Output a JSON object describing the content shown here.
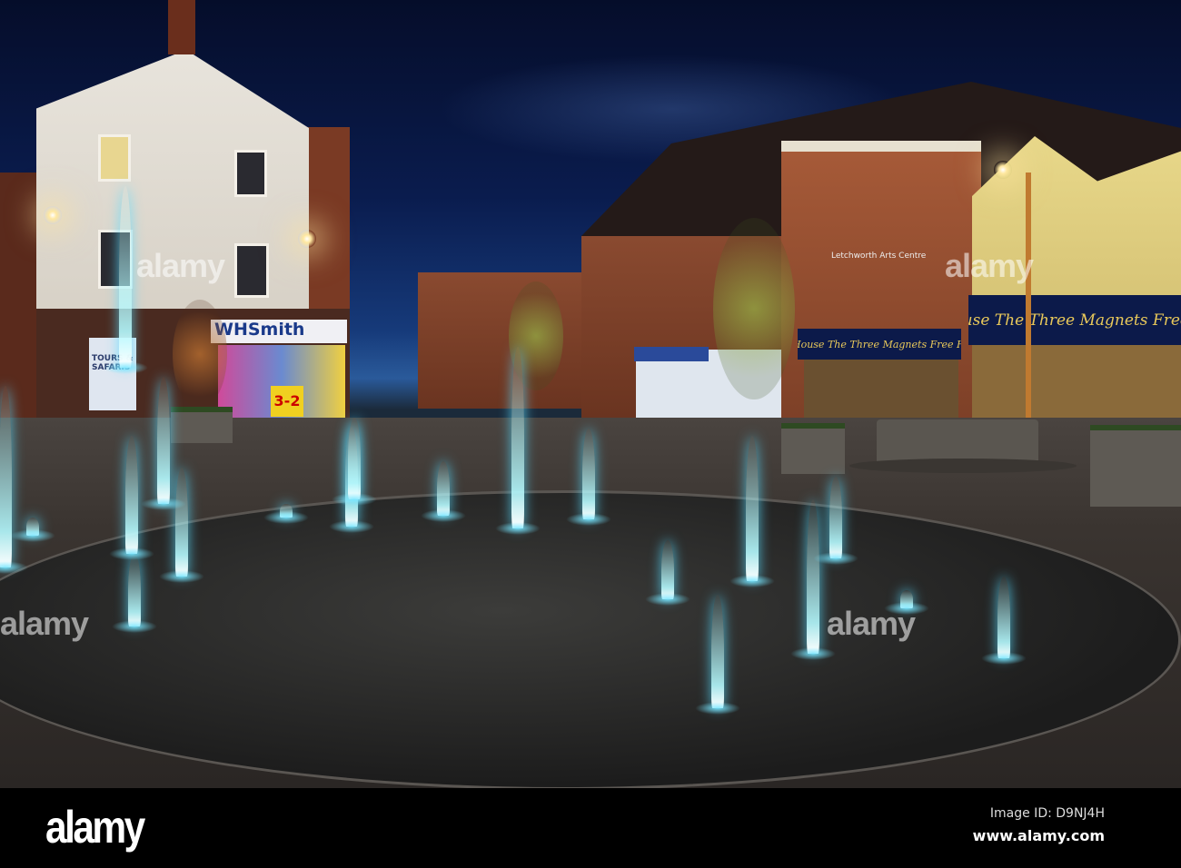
{
  "photo": {
    "signs": {
      "whsmith": "WHSmith",
      "three_magnets_left": "The House  The Three Magnets  Free House",
      "three_magnets_right": "The House  The Three Magnets  Free House",
      "arts_centre": "Letchworth Arts Centre",
      "tours": "TOURS & SAFARIS",
      "promo": "3-2"
    },
    "watermark": "alamy"
  },
  "footer": {
    "logo": "alamy",
    "image_id": "Image ID: D9NJ4H",
    "website": "www.alamy.com"
  }
}
